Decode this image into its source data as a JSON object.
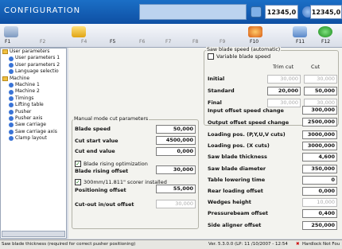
{
  "title": "CONFIGURATION",
  "counters": [
    "12345,0",
    "12345,0"
  ],
  "fkeys": [
    "F1",
    "F2",
    "F4",
    "F5",
    "F6",
    "F7",
    "F8",
    "F9",
    "F10",
    "F11",
    "F12"
  ],
  "tree": [
    {
      "label": "User parameters",
      "type": "folder",
      "indent": 0
    },
    {
      "label": "User parameters 1",
      "type": "item",
      "indent": 1
    },
    {
      "label": "User parameters 2",
      "type": "item",
      "indent": 1
    },
    {
      "label": "Language selectio",
      "type": "item",
      "indent": 1
    },
    {
      "label": "Machine",
      "type": "folder",
      "indent": 0
    },
    {
      "label": "Machine 1",
      "type": "item",
      "indent": 1
    },
    {
      "label": "Machine 2",
      "type": "item",
      "indent": 1
    },
    {
      "label": "Timings",
      "type": "item",
      "indent": 1
    },
    {
      "label": "Lifting table",
      "type": "item",
      "indent": 1
    },
    {
      "label": "Pusher",
      "type": "item",
      "indent": 1
    },
    {
      "label": "Pusher axis",
      "type": "item",
      "indent": 1
    },
    {
      "label": "Saw carriage",
      "type": "item",
      "indent": 1
    },
    {
      "label": "Saw carriage axis",
      "type": "item",
      "indent": 1
    },
    {
      "label": "Clamp layout",
      "type": "item",
      "indent": 1
    }
  ],
  "manual": {
    "title": "Manual mode cut parameters",
    "blade_speed_label": "Blade speed",
    "blade_speed": "50,000",
    "cut_start_label": "Cut start value",
    "cut_start": "4500,000",
    "cut_end_label": "Cut end value",
    "cut_end": "0,000",
    "rising_opt_label": "Blade rising optimization",
    "rising_offset_label": "Blade rising offset",
    "rising_offset": "30,000",
    "scorer_label": "300mm/11.811\" scorer installed",
    "positioning_label": "Positioning offset",
    "positioning": "55,000",
    "cutout_label": "Cut-out in/out offset",
    "cutout": "30,000"
  },
  "auto": {
    "title": "Saw blade speed (automatic)",
    "variable_label": "Variable blade speed",
    "col_trim": "Trim cut",
    "col_cut": "Cut",
    "rows": [
      {
        "label": "Initial",
        "trim": "30,000",
        "cut": "30,000",
        "trim_dis": true,
        "cut_dis": true
      },
      {
        "label": "Standard",
        "trim": "20,000",
        "cut": "50,000",
        "trim_dis": false,
        "cut_dis": false
      },
      {
        "label": "Final",
        "trim": "30,000",
        "cut": "30,000",
        "trim_dis": true,
        "cut_dis": true
      }
    ],
    "input_change_label": "Input offset speed change",
    "input_change": "300,000",
    "output_change_label": "Output offset speed change",
    "output_change": "2500,000"
  },
  "params": [
    {
      "label": "Loading pos. (P,Y,U,V cuts)",
      "value": "3000,000",
      "dis": false
    },
    {
      "label": "Loading pos. (X cuts)",
      "value": "3000,000",
      "dis": false
    },
    {
      "label": "Saw blade thickness",
      "value": "4,600",
      "dis": false
    },
    {
      "label": "Saw blade diameter",
      "value": "350,000",
      "dis": false
    },
    {
      "label": "Table lowering time",
      "value": "0",
      "dis": false
    },
    {
      "label": "Rear loading offset",
      "value": "0,000",
      "dis": false
    },
    {
      "label": "Wedges height",
      "value": "10,000",
      "dis": true
    },
    {
      "label": "Pressurebeam offset",
      "value": "0,400",
      "dis": false
    },
    {
      "label": "Side aligner offset",
      "value": "250,000",
      "dis": false
    }
  ],
  "status": {
    "left": "Saw blade thickness (required for correct pusher positioning)",
    "version": "Ver. 5.3.0.0 (LP: 11 /10/2007 - 12:54",
    "lock": "Hardlock Not Fou"
  }
}
